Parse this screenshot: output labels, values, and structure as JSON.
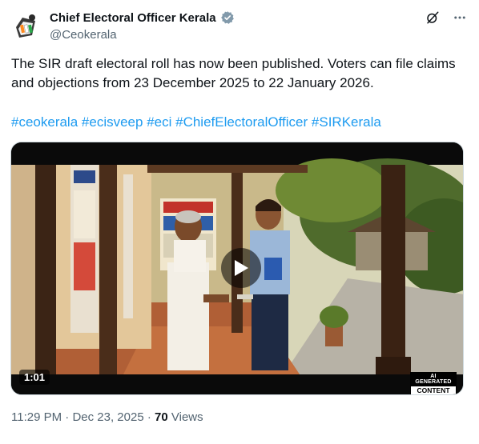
{
  "author": {
    "name": "Chief Electoral Officer Kerala",
    "handle": "@Ceokerala",
    "verified_color": "#829aab"
  },
  "header": {
    "grok_icon": "grok-icon",
    "more_icon": "more-dots-icon"
  },
  "tweet": {
    "text": "The SIR draft electoral roll has now been published. Voters can file claims and objections from 23 December 2025 to 22 January 2026.",
    "hashtags": [
      "#ceokerala",
      "#ecisveep",
      "#eci",
      "#ChiefElectoralOfficer",
      "#SIRKerala"
    ],
    "hashtag_color": "#1d9bf0"
  },
  "video": {
    "duration": "1:01",
    "ai_label_top": "AI GENERATED",
    "ai_label_bottom": "CONTENT",
    "play_icon": "play-icon"
  },
  "meta": {
    "time": "11:29 PM",
    "separator": "·",
    "date": "Dec 23, 2025",
    "views_count": "70",
    "views_label": "Views"
  }
}
